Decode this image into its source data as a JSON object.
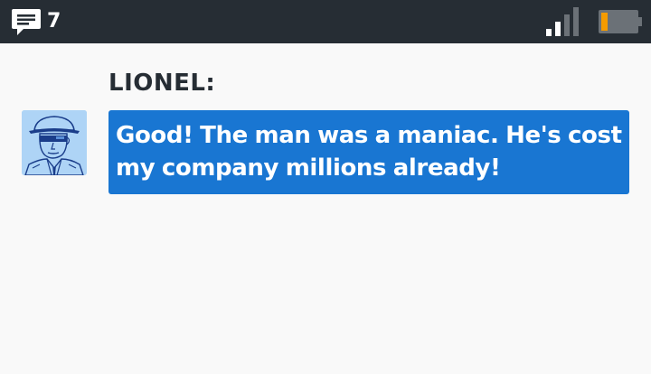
{
  "status_bar": {
    "message_icon": "chat-bubble-icon",
    "message_count": "7",
    "signal_icon": "signal-strength-icon",
    "battery_icon": "battery-low-icon",
    "battery_level": 0.15,
    "colors": {
      "background": "#262d34",
      "battery_fill": "#f59b00"
    }
  },
  "conversation": {
    "speaker": "LIONEL:",
    "avatar_icon": "lionel-portrait-avatar",
    "message": "Good! The man was a maniac. He's cost my company millions already!",
    "colors": {
      "bubble": "#1976d2",
      "avatar_background": "#aed4f6"
    }
  }
}
